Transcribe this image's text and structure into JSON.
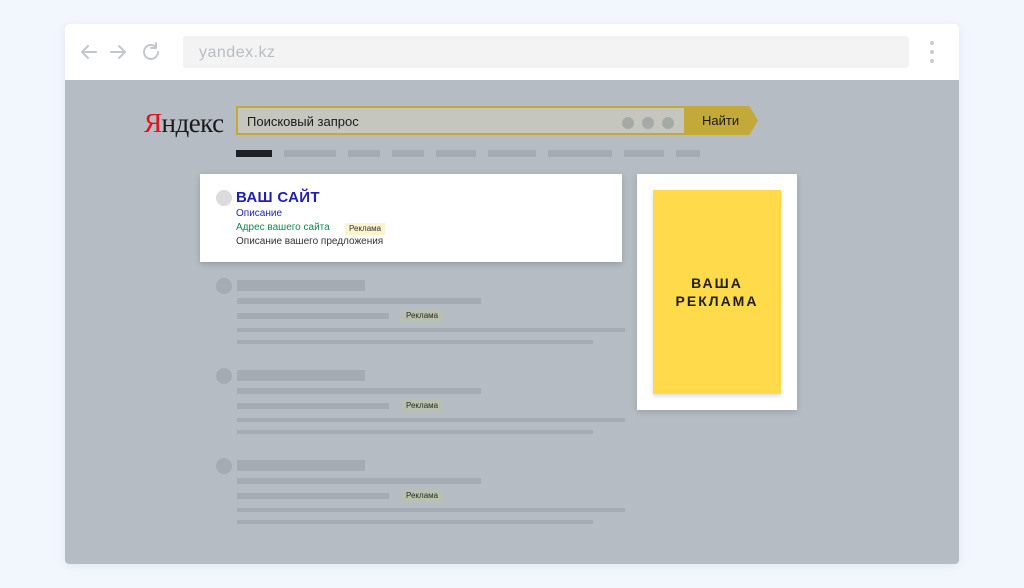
{
  "browser": {
    "url": "yandex.kz",
    "icons": [
      "back-arrow-icon",
      "forward-arrow-icon",
      "reload-icon",
      "kebab-menu-icon"
    ]
  },
  "logo": {
    "first_letter": "Я",
    "rest": "ндекс"
  },
  "search": {
    "query": "Поисковый запрос",
    "button_label": "Найти"
  },
  "ad_result": {
    "title": "ВАШ САЙТ",
    "description": "Описание",
    "url_text": "Адрес вашего сайта",
    "badge": "Реклама",
    "offer": "Описание вашего предложения"
  },
  "placeholder_results": [
    {
      "badge": "Реклама"
    },
    {
      "badge": "Реклама"
    },
    {
      "badge": "Реклама"
    }
  ],
  "side_ad": {
    "line1": "ВАША",
    "line2": "РЕКЛАМА"
  },
  "colors": {
    "page_background": "#f2f7fd",
    "overlay": "#b5bcc3",
    "accent_button": "#c3a93a",
    "side_ad_yellow": "#ffda4b",
    "link_blue": "#1f1fb2",
    "url_green": "#12874f",
    "logo_red": "#e5101b"
  }
}
